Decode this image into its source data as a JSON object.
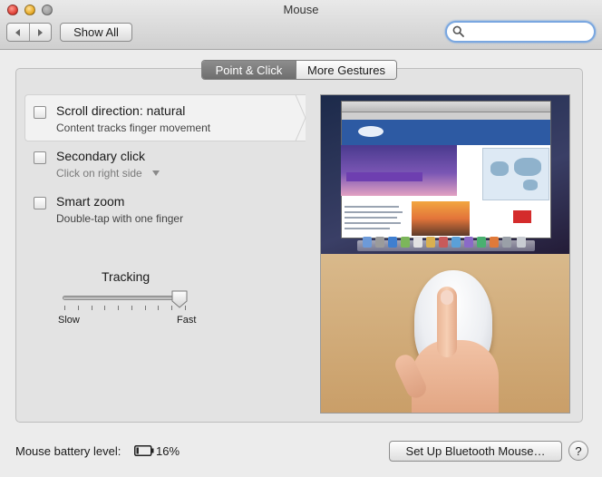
{
  "window": {
    "title": "Mouse"
  },
  "toolbar": {
    "back_icon": "back-arrow-icon",
    "forward_icon": "forward-arrow-icon",
    "show_all_label": "Show All",
    "search": {
      "value": "",
      "placeholder": ""
    }
  },
  "tabs": [
    {
      "label": "Point & Click",
      "selected": true
    },
    {
      "label": "More Gestures",
      "selected": false
    }
  ],
  "options": [
    {
      "title": "Scroll direction: natural",
      "subtitle": "Content tracks finger movement",
      "checked": false,
      "highlighted": true
    },
    {
      "title": "Secondary click",
      "subtitle": "Click on right side",
      "checked": false,
      "has_dropdown": true
    },
    {
      "title": "Smart zoom",
      "subtitle": "Double-tap with one finger",
      "checked": false
    }
  ],
  "tracking": {
    "label": "Tracking",
    "min_label": "Slow",
    "max_label": "Fast",
    "value_fraction": 1.0,
    "tick_count": 10
  },
  "battery": {
    "label": "Mouse battery level:",
    "value": "16%",
    "fraction": 0.16
  },
  "footer": {
    "bluetooth_button": "Set Up Bluetooth Mouse…",
    "help_label": "?"
  },
  "colors": {
    "accent": "#7aa7e0",
    "active_tab": "#7b7b7b",
    "panel": "#e3e3e3"
  }
}
